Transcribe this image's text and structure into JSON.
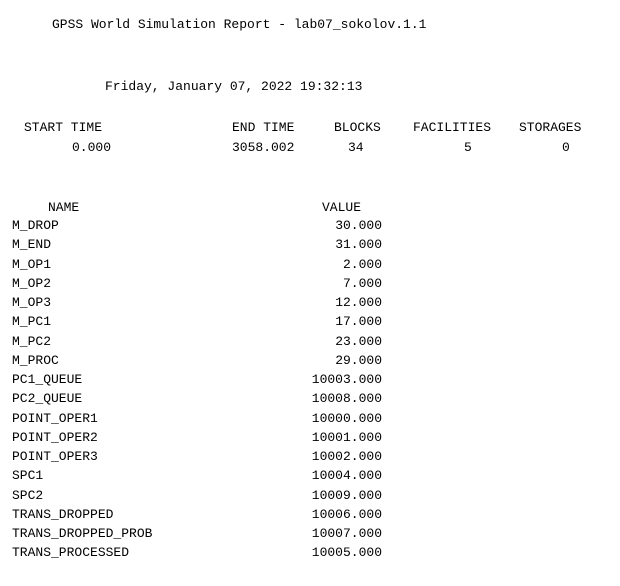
{
  "report": {
    "title": "GPSS World Simulation Report - lab07_sokolov.1.1",
    "datetime": "Friday, January 07, 2022 19:32:13"
  },
  "summary": {
    "headers": {
      "start_time": "START TIME",
      "end_time": "END TIME",
      "blocks": "BLOCKS",
      "facilities": "FACILITIES",
      "storages": "STORAGES"
    },
    "values": {
      "start_time": "0.000",
      "end_time": "3058.002",
      "blocks": "34",
      "facilities": "5",
      "storages": "0"
    }
  },
  "names_table": {
    "headers": {
      "name": "NAME",
      "value": "VALUE"
    },
    "rows": [
      {
        "name": "M_DROP",
        "value": "30.000"
      },
      {
        "name": "M_END",
        "value": "31.000"
      },
      {
        "name": "M_OP1",
        "value": "2.000"
      },
      {
        "name": "M_OP2",
        "value": "7.000"
      },
      {
        "name": "M_OP3",
        "value": "12.000"
      },
      {
        "name": "M_PC1",
        "value": "17.000"
      },
      {
        "name": "M_PC2",
        "value": "23.000"
      },
      {
        "name": "M_PROC",
        "value": "29.000"
      },
      {
        "name": "PC1_QUEUE",
        "value": "10003.000"
      },
      {
        "name": "PC2_QUEUE",
        "value": "10008.000"
      },
      {
        "name": "POINT_OPER1",
        "value": "10000.000"
      },
      {
        "name": "POINT_OPER2",
        "value": "10001.000"
      },
      {
        "name": "POINT_OPER3",
        "value": "10002.000"
      },
      {
        "name": "SPC1",
        "value": "10004.000"
      },
      {
        "name": "SPC2",
        "value": "10009.000"
      },
      {
        "name": "TRANS_DROPPED",
        "value": "10006.000"
      },
      {
        "name": "TRANS_DROPPED_PROB",
        "value": "10007.000"
      },
      {
        "name": "TRANS_PROCESSED",
        "value": "10005.000"
      }
    ]
  }
}
